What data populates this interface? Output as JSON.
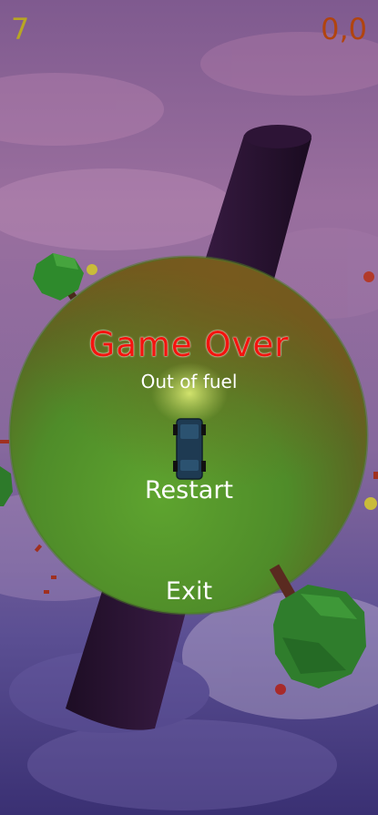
{
  "hud": {
    "score": "7",
    "distance": "0,0"
  },
  "game_over": {
    "title": "Game Over",
    "reason": "Out of fuel"
  },
  "menu": {
    "restart_label": "Restart",
    "exit_label": "Exit"
  },
  "colors": {
    "score": "#b8a623",
    "distance": "#b1440f",
    "title": "#f3140f",
    "planet": "#5e9a2e",
    "sky": "#6f4f86"
  }
}
